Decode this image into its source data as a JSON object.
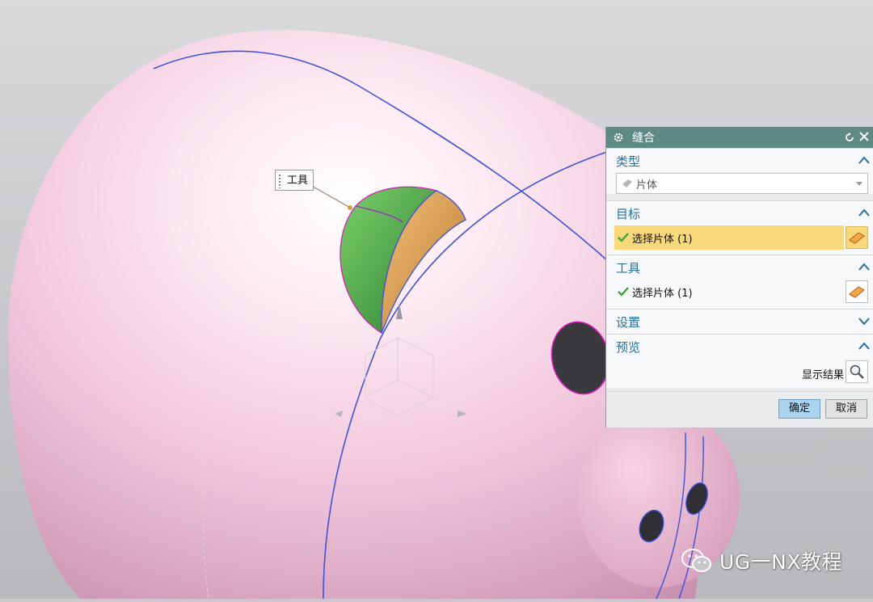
{
  "viewport": {
    "callout_label": "工具",
    "watermark_text": "UG一NX教程"
  },
  "dialog": {
    "title": "缝合",
    "icons": {
      "title": "gear-icon",
      "reset": "reset-icon",
      "close": "close-icon"
    },
    "sections": {
      "type": {
        "label": "类型",
        "dropdown_value": "片体"
      },
      "target": {
        "label": "目标",
        "selection_label": "选择片体 (1)"
      },
      "tool": {
        "label": "工具",
        "selection_label": "选择片体 (1)"
      },
      "settings": {
        "label": "设置"
      },
      "preview": {
        "label": "预览",
        "show_result_label": "显示结果"
      }
    },
    "buttons": {
      "ok": "确定",
      "cancel": "取消"
    }
  },
  "colors": {
    "title_bar": "#5f8a83",
    "section_text": "#2b6f9d",
    "active_highlight": "#f8d87a",
    "ok_button": "#a9d3ef",
    "model_body": "#f3c8df",
    "tool_face_green": "#4fae4a",
    "tool_face_orange": "#e0a34f"
  }
}
